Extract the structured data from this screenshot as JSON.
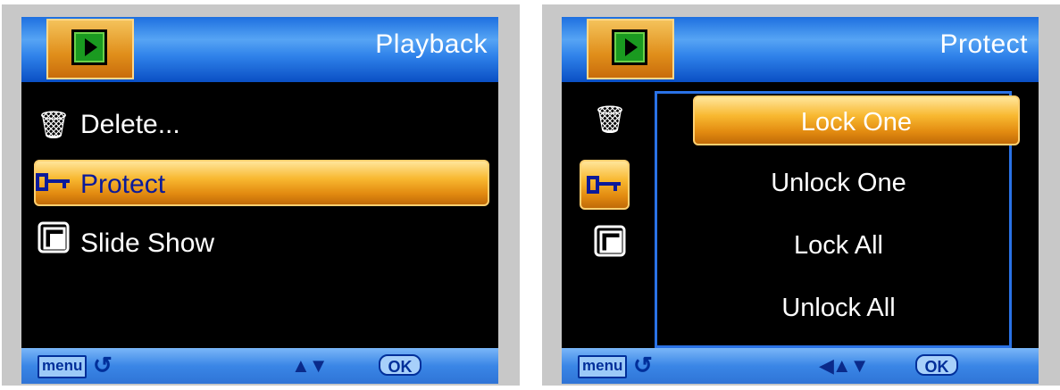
{
  "left_screen": {
    "title": "Playback",
    "items": [
      {
        "label": "Delete...",
        "icon": "trash-icon"
      },
      {
        "label": "Protect",
        "icon": "key-icon",
        "selected": true
      },
      {
        "label": "Slide Show",
        "icon": "slideshow-icon"
      }
    ],
    "bottom": {
      "menu_label": "menu",
      "ok_label": "OK",
      "nav": "▲▼"
    }
  },
  "right_screen": {
    "title": "Protect",
    "side_icons": [
      "trash-icon",
      "key-icon",
      "slideshow-icon"
    ],
    "options": [
      {
        "label": "Lock One",
        "selected": true
      },
      {
        "label": "Unlock One"
      },
      {
        "label": "Lock All"
      },
      {
        "label": "Unlock All"
      }
    ],
    "bottom": {
      "menu_label": "menu",
      "ok_label": "OK",
      "nav": "◀▲▼"
    }
  },
  "colors": {
    "accent_orange": "#f0a020",
    "topbar_blue": "#2f82ea",
    "selected_text": "#0a1a9a"
  }
}
